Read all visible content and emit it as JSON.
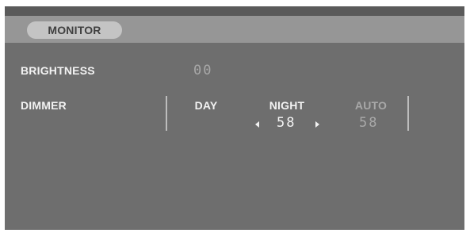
{
  "tab": {
    "label": "MONITOR"
  },
  "brightness": {
    "label": "BRIGHTNESS",
    "value": "00"
  },
  "dimmer": {
    "label": "DIMMER",
    "day": {
      "label": "DAY"
    },
    "night": {
      "label": "NIGHT",
      "value": "58"
    },
    "auto": {
      "label": "AUTO",
      "value": "58"
    }
  },
  "icons": {
    "night_decrement": "chevron-left-icon",
    "night_increment": "chevron-right-icon"
  },
  "colors": {
    "panel_background": "#6e6e6e",
    "tab_bar": "#969696",
    "tab_pill": "#c4c4c4",
    "active_text": "#f2f2f2",
    "inactive_text": "#a8a8a8"
  }
}
